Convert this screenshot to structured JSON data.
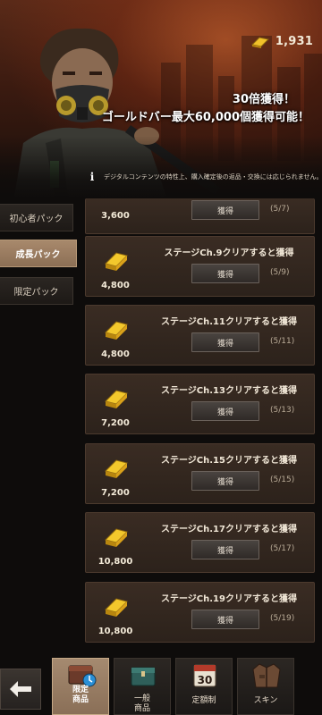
{
  "header": {
    "gold_count": "1,931",
    "promo_line1": "30倍獲得！",
    "promo_line2": "ゴールドバー最大60,000個獲得可能！",
    "disclaimer": "デジタルコンテンツの特性上、購入確定後の返品・交換には応じられません。"
  },
  "side_tabs": [
    {
      "label": "初心者パック",
      "active": false
    },
    {
      "label": "成長パック",
      "active": true
    },
    {
      "label": "限定パック",
      "active": false
    }
  ],
  "rewards": [
    {
      "amount": "3,600",
      "condition": "",
      "button": "獲得",
      "progress": "(5/7)"
    },
    {
      "amount": "4,800",
      "condition": "ステージCh.9クリアすると獲得",
      "button": "獲得",
      "progress": "(5/9)"
    },
    {
      "amount": "4,800",
      "condition": "ステージCh.11クリアすると獲得",
      "button": "獲得",
      "progress": "(5/11)"
    },
    {
      "amount": "7,200",
      "condition": "ステージCh.13クリアすると獲得",
      "button": "獲得",
      "progress": "(5/13)"
    },
    {
      "amount": "7,200",
      "condition": "ステージCh.15クリアすると獲得",
      "button": "獲得",
      "progress": "(5/15)"
    },
    {
      "amount": "10,800",
      "condition": "ステージCh.17クリアすると獲得",
      "button": "獲得",
      "progress": "(5/17)"
    },
    {
      "amount": "10,800",
      "condition": "ステージCh.19クリアすると獲得",
      "button": "獲得",
      "progress": "(5/19)"
    }
  ],
  "bottom_nav": [
    {
      "label": "限定\n商品",
      "icon": "limited-shop-icon",
      "active": true
    },
    {
      "label": "一般\n商品",
      "icon": "general-shop-icon",
      "active": false
    },
    {
      "label": "定額制",
      "icon": "calendar-icon",
      "icon_text": "30",
      "active": false
    },
    {
      "label": "スキン",
      "icon": "jacket-icon",
      "active": false
    }
  ],
  "colors": {
    "gold": "#e8b41a",
    "active_tab": "#9a7d63",
    "row_bg": "#33271f"
  }
}
